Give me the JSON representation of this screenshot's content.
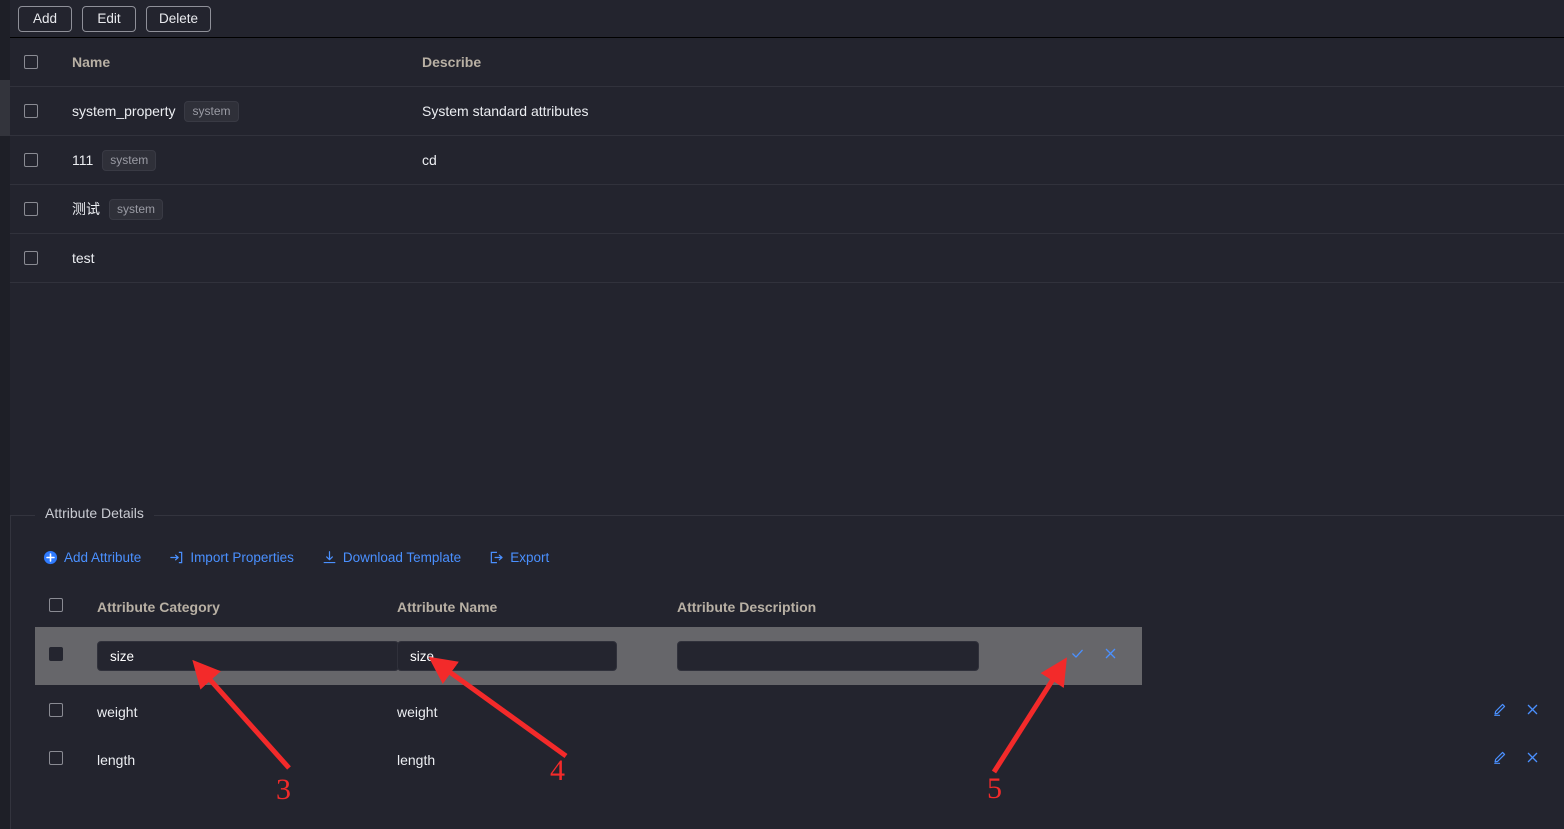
{
  "toolbar": {
    "buttons": [
      {
        "label": "Add",
        "name": "add-button"
      },
      {
        "label": "Edit",
        "name": "edit-button"
      },
      {
        "label": "Delete",
        "name": "delete-button"
      }
    ]
  },
  "main_table": {
    "columns": {
      "name": "Name",
      "describe": "Describe"
    },
    "rows": [
      {
        "name": "system_property",
        "tag": "system",
        "describe": "System standard attributes"
      },
      {
        "name": "111",
        "tag": "system",
        "describe": "cd"
      },
      {
        "name": "测试",
        "tag": "system",
        "describe": ""
      },
      {
        "name": "test",
        "tag": "",
        "describe": ""
      }
    ]
  },
  "details": {
    "legend": "Attribute Details",
    "actions": [
      {
        "label": "Add Attribute",
        "icon": "plus-circle-icon",
        "name": "add-attribute-link"
      },
      {
        "label": "Import Properties",
        "icon": "import-icon",
        "name": "import-properties-link"
      },
      {
        "label": "Download Template",
        "icon": "download-icon",
        "name": "download-template-link"
      },
      {
        "label": "Export",
        "icon": "export-icon",
        "name": "export-link"
      }
    ],
    "columns": {
      "category": "Attribute Category",
      "name": "Attribute Name",
      "description": "Attribute Description"
    },
    "editing_row": {
      "category_value": "size",
      "name_value": "size",
      "description_value": "",
      "confirm_icon": "check-icon",
      "cancel_icon": "close-icon"
    },
    "rows": [
      {
        "category": "weight",
        "name": "weight",
        "description": ""
      },
      {
        "category": "length",
        "name": "length",
        "description": ""
      }
    ]
  },
  "annotations": {
    "color": "#f32a2a",
    "markers": [
      {
        "label": "3"
      },
      {
        "label": "4"
      },
      {
        "label": "5"
      }
    ]
  }
}
